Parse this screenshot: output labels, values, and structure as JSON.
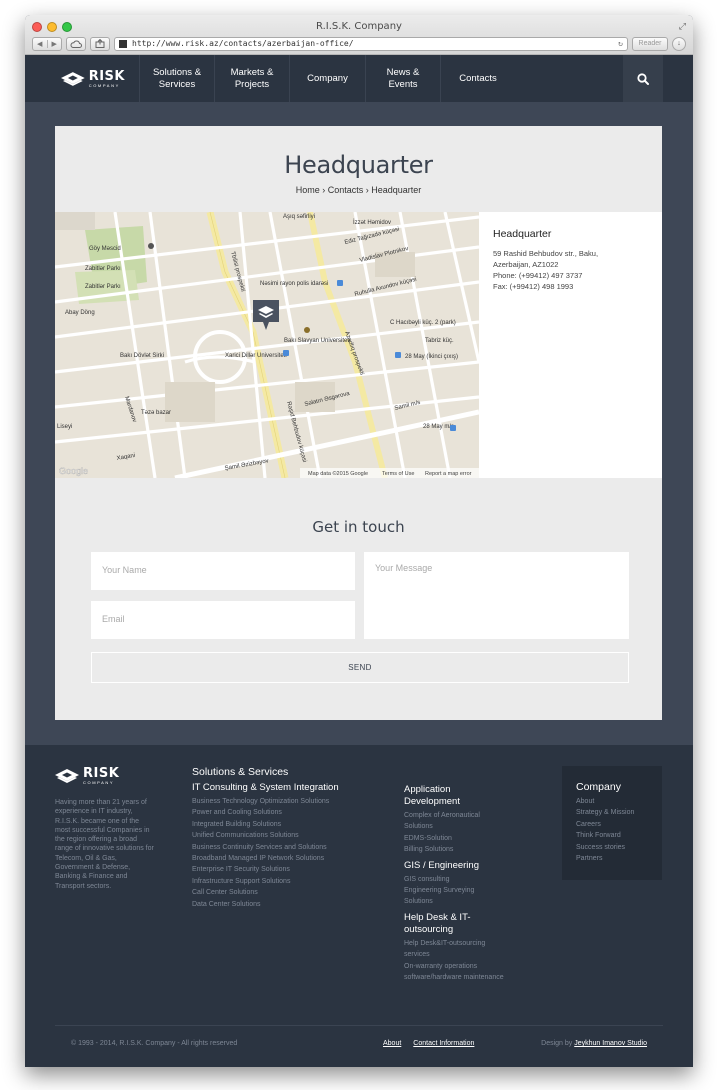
{
  "browser": {
    "title": "R.I.S.K. Company",
    "url": "http://www.risk.az/contacts/azerbaijan-office/",
    "reader_label": "Reader"
  },
  "nav": {
    "logo_text": "RISK",
    "logo_sub": "COMPANY",
    "items": [
      {
        "line1": "Solutions &",
        "line2": "Services"
      },
      {
        "line1": "Markets &",
        "line2": "Projects"
      },
      {
        "line1": "Company",
        "line2": ""
      },
      {
        "line1": "News & Events",
        "line2": ""
      },
      {
        "line1": "Contacts",
        "line2": ""
      }
    ]
  },
  "page": {
    "title": "Headquarter",
    "breadcrumb": [
      "Home",
      "Contacts",
      "Headquarter"
    ]
  },
  "map": {
    "labels": [
      "Aşıq səfirliyi",
      "İzzət Həmidov",
      "Göy Məscid",
      "Zabitlər Parkı",
      "Zabitlər Parkı",
      "Abay Döng",
      "Nəsimi rayon polis idarəsi",
      "Ruhulla Axundov küçəsi",
      "Vladislav Plotnikov",
      "C Hacıbəyli küç. 2 (park)",
      "Tabriz küç.",
      "Bakı Slavyan Universiteti",
      "Xarici Dillər Universiteti",
      "Bakı Dövlət Sirki",
      "28 May (İkinci çıxış)",
      "Səlatın Əsgərova",
      "Mardanov",
      "Təzə bazar",
      "Samil m/s",
      "28 May m/s",
      "Şamil Əzizbəyov",
      "Liseyi",
      "Rəşid Behbudov küçəsi",
      "Azadlıq prospekti",
      "Xaqani",
      "Ediz Tağızadə küçəsi",
      "Tbilisi prospekti"
    ],
    "attribution": "Map data ©2015 Google",
    "terms": "Terms of Use",
    "report": "Report a map error",
    "brand": "Google"
  },
  "office": {
    "title": "Headquarter",
    "address1": "59 Rashid Behbudov str., Baku,",
    "address2": "Azerbaijan, AZ1022",
    "phone": "Phone: (+99412) 497 3737",
    "fax": "Fax: (+99412) 498 1993"
  },
  "form": {
    "title": "Get in touch",
    "name_placeholder": "Your Name",
    "email_placeholder": "Email",
    "message_placeholder": "Your Message",
    "send_label": "SEND"
  },
  "footer": {
    "logo_text": "RISK",
    "logo_sub": "COMPANY",
    "about": "Having more than 21 years of experience in IT industry, R.I.S.K. became one of the most successful Companies in the region offering a broad range of innovative solutions for Telecom, Oil & Gas, Government & Defense, Banking & Finance and Transport sectors.",
    "solutions_title": "Solutions & Services",
    "it_title": "IT Consulting & System Integration",
    "it_items": [
      "Business Technology Optimization Solutions",
      "Power and Cooling Solutions",
      "Integrated Building Solutions",
      "Unified Communications Solutions",
      "Business Continuity Services and Solutions",
      "Broadband Managed IP Network Solutions",
      "Enterprise IT Security Solutions",
      "Infrastructure Support Solutions",
      "Call Center Solutions",
      "Data Center Solutions"
    ],
    "app_title": "Application Development",
    "app_items": [
      "Complex of Aeronautical Solutions",
      "EDMS-Solution",
      "Billing Solutions"
    ],
    "gis_title": "GIS / Engineering",
    "gis_items": [
      "GIS consulting",
      "Engineering Surveying Solutions"
    ],
    "help_title": "Help Desk & IT-outsourcing",
    "help_items": [
      "Help Desk&IT-outsourcing services",
      "On-warranty operations software/hardware maintenance"
    ],
    "company_title": "Company",
    "company_items": [
      "About",
      "Strategy & Mission",
      "Careers",
      "Think Forward",
      "Success stories",
      "Partners"
    ],
    "copyright": "© 1993 - 2014, R.I.S.K. Company - All rights reserved",
    "link_about": "About",
    "link_contact": "Contact Information",
    "design_prefix": "Design by",
    "design_link": "Jeykhun Imanov Studio"
  },
  "colors": {
    "nav_bg": "#2b3441",
    "page_bg": "#3e4756",
    "card_bg": "#ebebeb",
    "marker": "#4a5260"
  }
}
